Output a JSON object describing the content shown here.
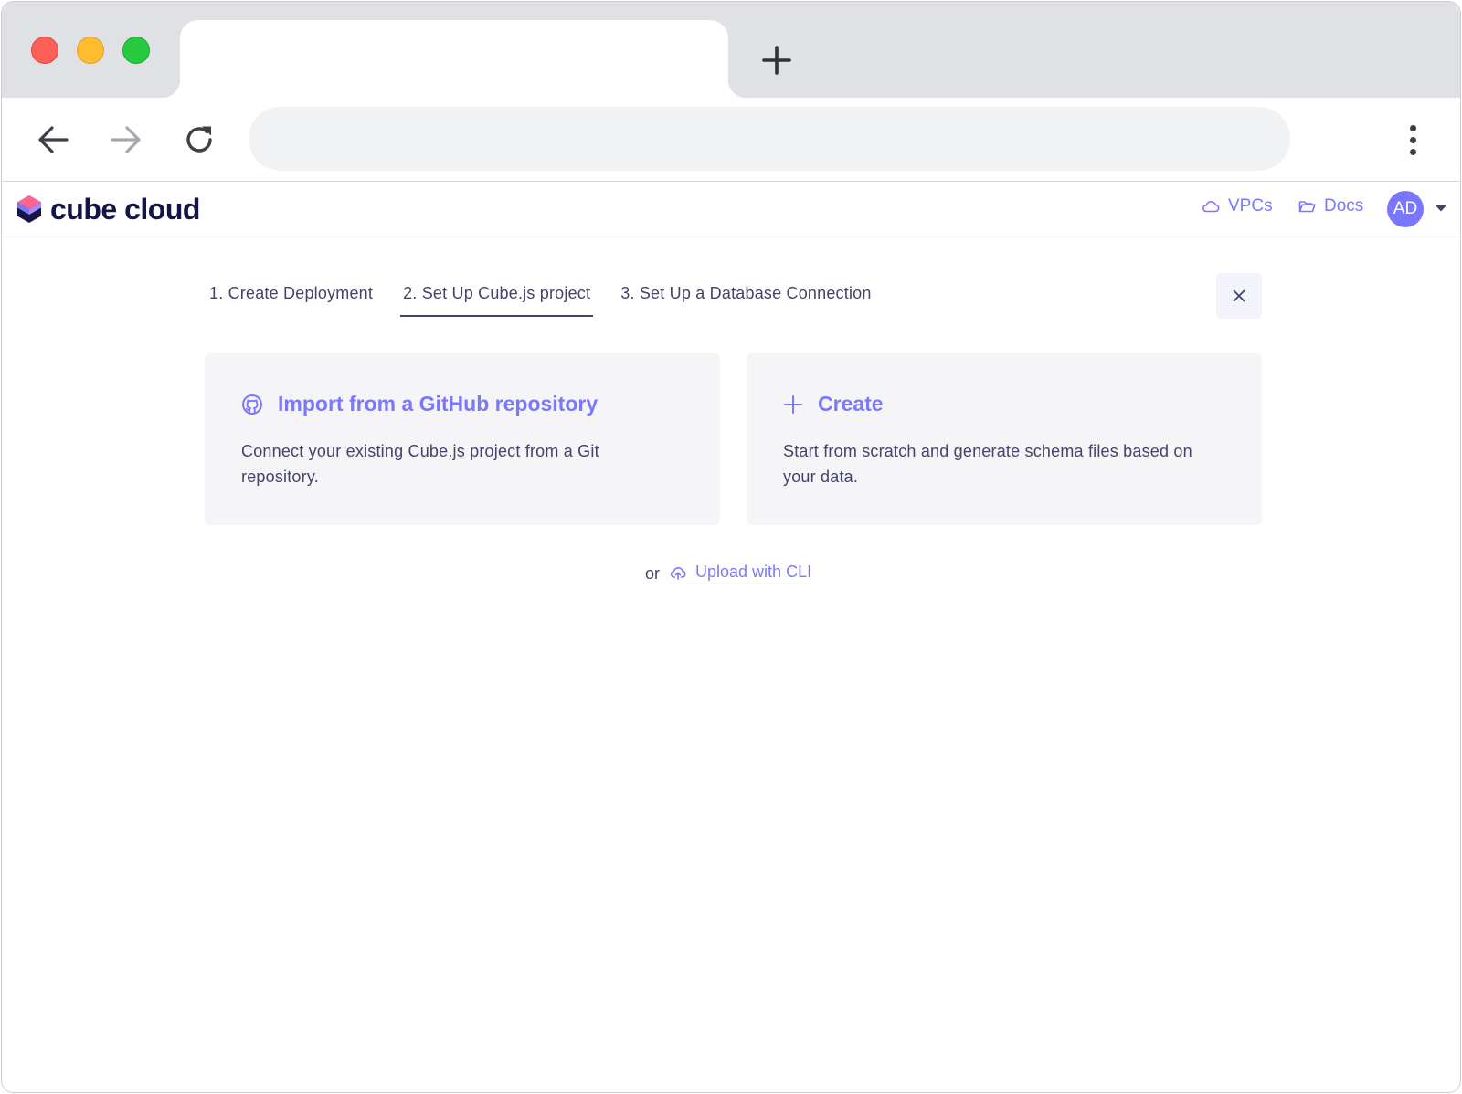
{
  "browser": {
    "address_value": "",
    "new_tab_icon": "plus-icon",
    "back_icon": "arrow-left-icon",
    "forward_icon": "arrow-right-icon",
    "reload_icon": "reload-icon",
    "menu_icon": "kebab-menu-icon"
  },
  "header": {
    "logo_text": "cube cloud",
    "links": [
      {
        "label": "VPCs",
        "icon": "cloud-icon"
      },
      {
        "label": "Docs",
        "icon": "folder-icon"
      }
    ],
    "avatar_initials": "AD"
  },
  "wizard": {
    "steps": [
      {
        "label": "1. Create Deployment",
        "active": false
      },
      {
        "label": "2. Set Up Cube.js project",
        "active": true
      },
      {
        "label": "3. Set Up a Database Connection",
        "active": false
      }
    ],
    "close_label": "×"
  },
  "options": [
    {
      "title": "Import from a GitHub repository",
      "description": "Connect your existing Cube.js project from a Git repository.",
      "icon": "github-icon"
    },
    {
      "title": "Create",
      "description": "Start from scratch and generate schema files based on your data.",
      "icon": "plus-icon"
    }
  ],
  "upload": {
    "prefix": "or",
    "link_label": "Upload with CLI",
    "icon": "cloud-upload-icon"
  },
  "colors": {
    "accent": "#7a77ff",
    "text": "#43436b",
    "logo_text": "#141446",
    "card_bg": "#f5f5f7",
    "tabstrip_bg": "#dfe1e4"
  }
}
